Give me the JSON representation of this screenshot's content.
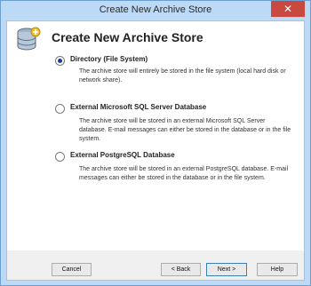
{
  "window": {
    "title": "Create New Archive Store",
    "close_glyph": "✕"
  },
  "header": {
    "title": "Create New Archive Store",
    "icon": "database-icon"
  },
  "options": [
    {
      "label": "Directory (File System)",
      "checked": true,
      "description": "The archive store will entirely be stored in the file system (local hard disk or network share)."
    },
    {
      "label": "External Microsoft SQL Server Database",
      "checked": false,
      "description": "The archive store will be stored in an external Microsoft SQL Server database. E-mail messages can either be stored in the database or in the file system."
    },
    {
      "label": "External PostgreSQL Database",
      "checked": false,
      "description": "The archive store will be stored in an external PostgreSQL database. E-mail messages can either be stored in the database or in the file system."
    }
  ],
  "buttons": {
    "cancel": "Cancel",
    "back": "< Back",
    "next": "Next >",
    "help": "Help"
  }
}
